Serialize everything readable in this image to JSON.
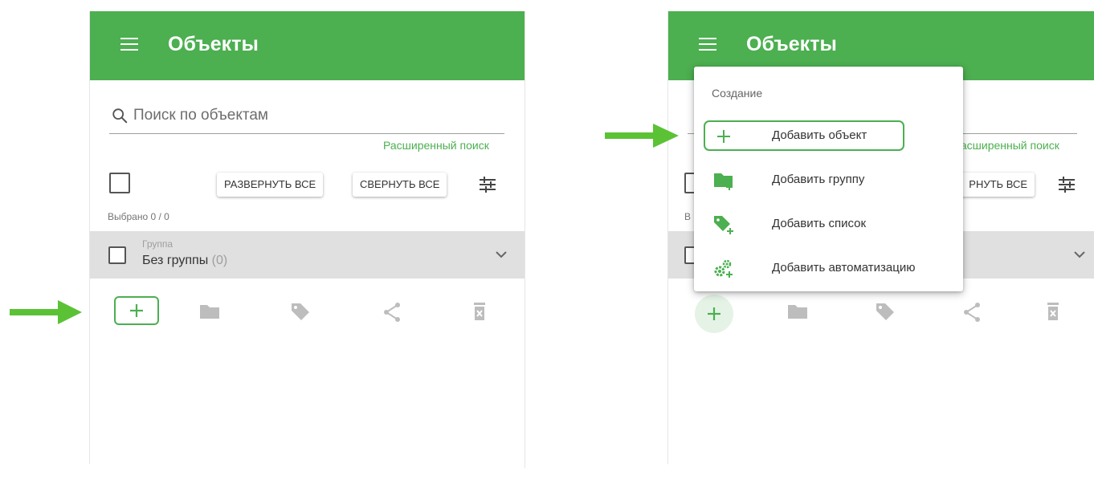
{
  "colors": {
    "brand_green": "#4caf50",
    "arrow_green": "#5bc236",
    "menu_icon_green": "#4caf50"
  },
  "left_panel": {
    "title": "Объекты",
    "search_placeholder": "Поиск по объектам",
    "advanced_search": "Расширенный поиск",
    "expand_all": "РАЗВЕРНУТЬ ВСЕ",
    "collapse_all": "СВЕРНУТЬ ВСЕ",
    "selected": "Выбрано 0 / 0",
    "group_caption": "Группа",
    "group_name": "Без группы",
    "group_count": "(0)",
    "toolbar_icons": [
      "plus-icon",
      "folder-icon",
      "tag-icon",
      "share-icon",
      "trash-icon"
    ]
  },
  "right_panel": {
    "title": "Объекты",
    "advanced_search_partial": "Расширенный поиск",
    "collapse_all_partial": "РНУТЬ ВСЕ",
    "selected_partial": "В"
  },
  "dropdown": {
    "header": "Создание",
    "items": [
      {
        "label": "Добавить объект",
        "icon": "plus-icon"
      },
      {
        "label": "Добавить группу",
        "icon": "folder-plus-icon"
      },
      {
        "label": "Добавить список",
        "icon": "tag-plus-icon"
      },
      {
        "label": "Добавить автоматизацию",
        "icon": "gears-plus-icon"
      }
    ]
  }
}
